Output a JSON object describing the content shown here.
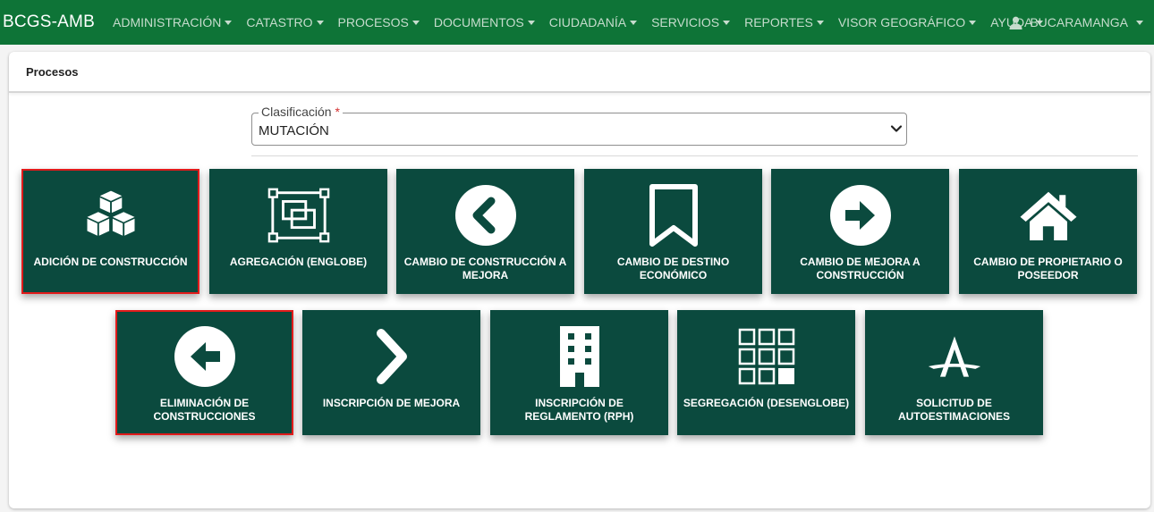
{
  "navbar": {
    "brand": "BCGS-AMB",
    "menu": [
      "ADMINISTRACIÓN",
      "CATASTRO",
      "PROCESOS",
      "DOCUMENTOS",
      "CIUDADANÍA",
      "SERVICIOS",
      "REPORTES",
      "VISOR GEOGRÁFICO",
      "AYUDA"
    ],
    "user": "BUCARAMANGA",
    "user_icon": "user-icon",
    "colors": {
      "background": "#0e7437",
      "menu_text": "#c6dccd",
      "brand_text": "#ffffff"
    }
  },
  "page": {
    "title": "Procesos",
    "classification": {
      "label": "Clasificación",
      "required_mark": "*",
      "value": "MUTACIÓN"
    }
  },
  "tiles": [
    {
      "label": "ADICIÓN DE CONSTRUCCIÓN",
      "icon": "cubes-icon",
      "selected": true
    },
    {
      "label": "AGREGACIÓN (ENGLOBE)",
      "icon": "object-group-icon",
      "selected": false
    },
    {
      "label": "CAMBIO DE CONSTRUCCIÓN A MEJORA",
      "icon": "chevron-left-circle-icon",
      "selected": false
    },
    {
      "label": "CAMBIO DE DESTINO ECONÓMICO",
      "icon": "bookmark-icon",
      "selected": false
    },
    {
      "label": "CAMBIO DE MEJORA A CONSTRUCCIÓN",
      "icon": "arrow-right-circle-icon",
      "selected": false
    },
    {
      "label": "CAMBIO DE PROPIETARIO O POSEEDOR",
      "icon": "home-icon",
      "selected": false
    },
    {
      "label": "ELIMINACIÓN DE CONSTRUCCIONES",
      "icon": "arrow-left-circle-icon",
      "selected": true
    },
    {
      "label": "INSCRIPCIÓN DE MEJORA",
      "icon": "chevron-right-icon",
      "selected": false
    },
    {
      "label": "INSCRIPCIÓN DE REGLAMENTO (RPH)",
      "icon": "building-icon",
      "selected": false
    },
    {
      "label": "SEGREGACIÓN (DESENGLOBE)",
      "icon": "grid-icon",
      "selected": false
    },
    {
      "label": "SOLICITUD DE AUTOESTIMACIONES",
      "icon": "autoestimacion-logo-icon",
      "selected": false
    }
  ],
  "colors": {
    "tile": "#0b4a3e",
    "selected_border": "#e11b1b",
    "required": "#d32f2f"
  }
}
